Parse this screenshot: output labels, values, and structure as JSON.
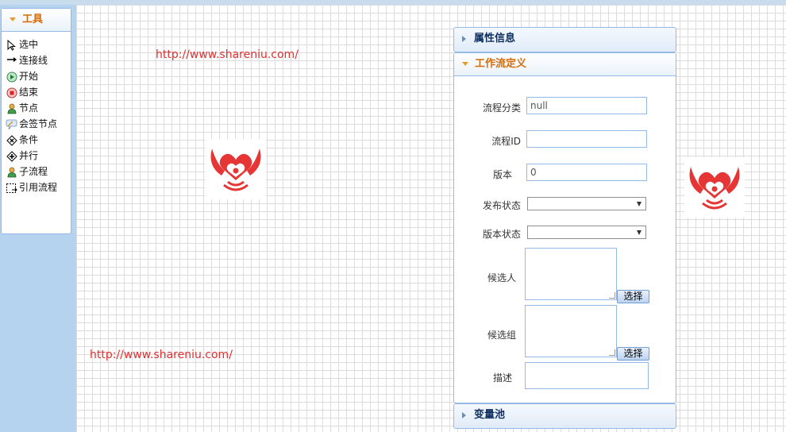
{
  "tools": {
    "title": "工具",
    "items": [
      {
        "label": "选中",
        "icon": "cursor-arrow-icon"
      },
      {
        "label": "连接线",
        "icon": "connector-arrow-icon"
      },
      {
        "label": "开始",
        "icon": "start-green-circle-icon"
      },
      {
        "label": "结束",
        "icon": "end-red-circle-icon"
      },
      {
        "label": "节点",
        "icon": "user-node-icon"
      },
      {
        "label": "会签节点",
        "icon": "countersign-node-icon"
      },
      {
        "label": "条件",
        "icon": "condition-diamond-icon"
      },
      {
        "label": "并行",
        "icon": "parallel-diamond-icon"
      },
      {
        "label": "子流程",
        "icon": "subprocess-user-icon"
      },
      {
        "label": "引用流程",
        "icon": "reference-process-icon"
      }
    ]
  },
  "canvas": {
    "watermark_top": "http://www.shareniu.com/",
    "watermark_bottom": "http://www.shareniu.com/",
    "accent_color": "#e03030"
  },
  "panels": {
    "properties_title": "属性信息",
    "workflow_title": "工作流定义",
    "variables_title": "变量池"
  },
  "workflow_form": {
    "category_label": "流程分类",
    "category_value": "null",
    "process_id_label": "流程ID",
    "process_id_value": "",
    "version_label": "版本",
    "version_value": "0",
    "publish_status_label": "发布状态",
    "publish_status_value": "",
    "version_status_label": "版本状态",
    "version_status_value": "",
    "candidate_users_label": "候选人",
    "candidate_groups_label": "候选组",
    "description_label": "描述",
    "select_button_label": "选择"
  }
}
